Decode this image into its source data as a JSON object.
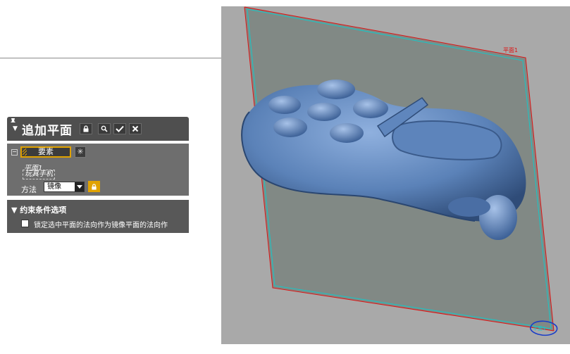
{
  "panel": {
    "title": "追加平面",
    "header_buttons": [
      "lock-icon",
      "search-icon",
      "check-icon",
      "close-icon"
    ],
    "elements_button": "要素",
    "elements_list": [
      "平面1",
      "玩具手机"
    ],
    "method_label": "方法",
    "method_value": "镜像",
    "constraint_title": "▼ 约束条件选项",
    "constraint_checkbox_label": "锁定选中平面的法向作为镜像平面的法向作",
    "accent_color": "#e0a200"
  },
  "viewport": {
    "plane_label": "平面1",
    "corner_label": "平面1",
    "plane_edge_color": "#e01010",
    "plane_edge_color_2": "#16c8c8",
    "model_color": "#5b82b8"
  }
}
